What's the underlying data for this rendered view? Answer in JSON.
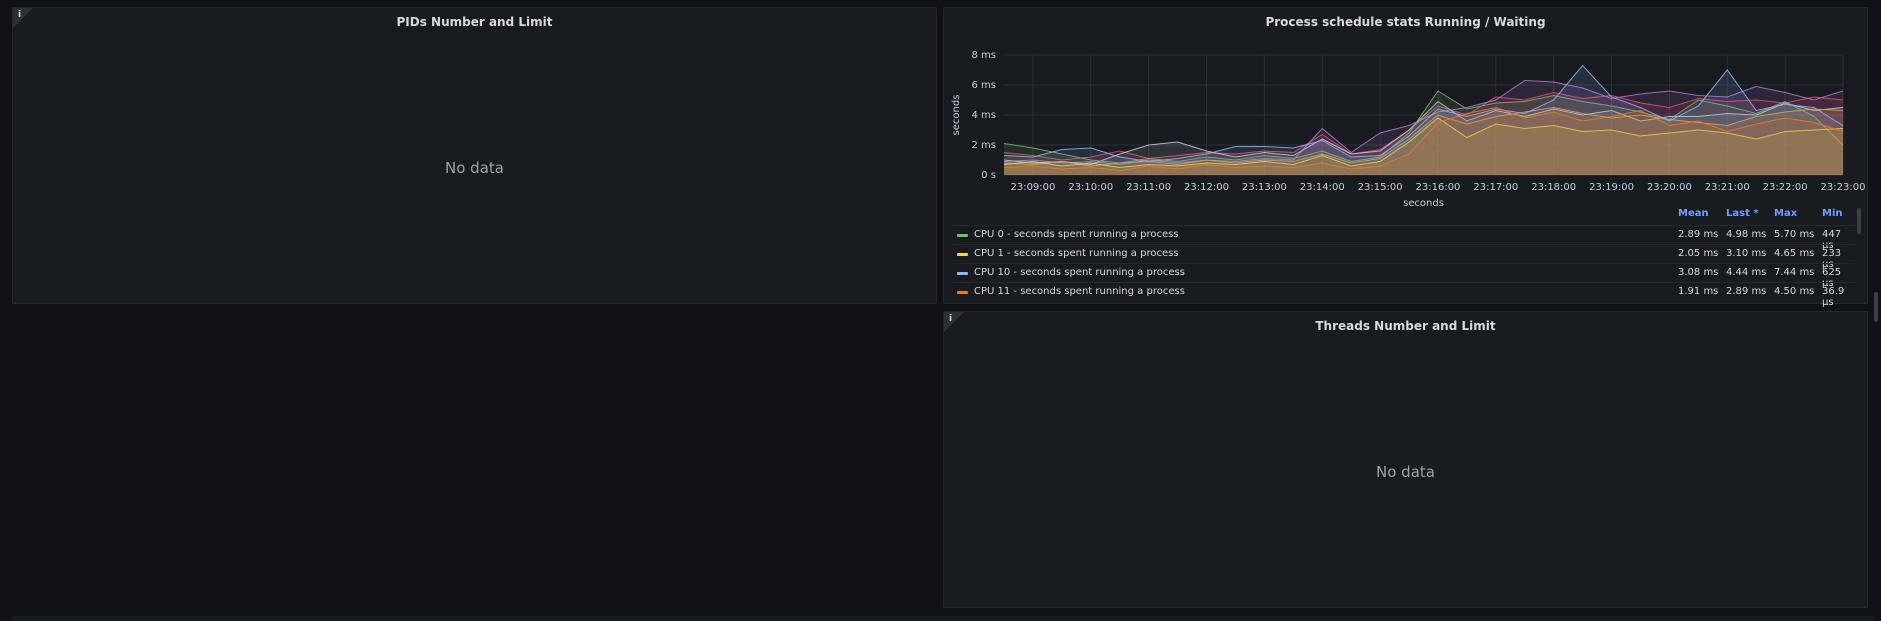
{
  "panels": {
    "pids": {
      "title": "PIDs Number and Limit",
      "empty_text": "No data"
    },
    "sched": {
      "title": "Process schedule stats Running / Waiting"
    },
    "threads": {
      "title": "Threads Number and Limit",
      "empty_text": "No data"
    }
  },
  "chart_data": {
    "type": "area",
    "title": "Process schedule stats Running / Waiting",
    "xlabel": "seconds",
    "ylabel": "seconds",
    "x": [
      "23:08:30",
      "23:09:00",
      "23:09:30",
      "23:10:00",
      "23:10:30",
      "23:11:00",
      "23:11:30",
      "23:12:00",
      "23:12:30",
      "23:13:00",
      "23:13:30",
      "23:14:00",
      "23:14:30",
      "23:15:00",
      "23:15:30",
      "23:16:00",
      "23:16:30",
      "23:17:00",
      "23:17:30",
      "23:18:00",
      "23:18:30",
      "23:19:00",
      "23:19:30",
      "23:20:00",
      "23:20:30",
      "23:21:00",
      "23:21:30",
      "23:22:00",
      "23:22:30",
      "23:23:00"
    ],
    "x_ticks": [
      "23:09:00",
      "23:10:00",
      "23:11:00",
      "23:12:00",
      "23:13:00",
      "23:14:00",
      "23:15:00",
      "23:16:00",
      "23:17:00",
      "23:18:00",
      "23:19:00",
      "23:20:00",
      "23:21:00",
      "23:22:00",
      "23:23:00"
    ],
    "y_ticks": [
      "0 s",
      "2 ms",
      "4 ms",
      "6 ms",
      "8 ms"
    ],
    "ylim": [
      0,
      8
    ],
    "y_unit": "ms",
    "grid": true,
    "legend_position": "bottom",
    "series": [
      {
        "name": "CPU 0 - seconds spent running a process",
        "color": "#73bf69",
        "values": [
          2.1,
          1.8,
          1.4,
          1.0,
          0.8,
          1.1,
          0.9,
          1.2,
          1.0,
          1.3,
          1.1,
          1.6,
          0.9,
          1.2,
          2.8,
          5.6,
          4.4,
          4.8,
          4.9,
          5.3,
          4.9,
          4.6,
          4.2,
          3.7,
          5.0,
          4.6,
          4.1,
          4.9,
          3.9,
          2.0
        ]
      },
      {
        "name": "CPU 1 - seconds spent running a process",
        "color": "#fade2a",
        "values": [
          0.7,
          0.9,
          0.6,
          0.8,
          0.5,
          0.7,
          0.6,
          0.8,
          0.7,
          0.9,
          0.7,
          1.3,
          0.6,
          0.9,
          2.2,
          3.8,
          2.5,
          3.4,
          3.1,
          3.3,
          2.9,
          3.0,
          2.6,
          2.8,
          3.0,
          2.8,
          2.4,
          2.9,
          3.0,
          3.1
        ]
      },
      {
        "name": "CPU 10 - seconds spent running a process",
        "color": "#8ab8ff",
        "values": [
          1.3,
          1.2,
          1.7,
          1.8,
          1.2,
          0.9,
          1.1,
          1.4,
          1.9,
          1.9,
          1.8,
          2.3,
          1.2,
          1.3,
          2.6,
          4.4,
          3.9,
          4.4,
          4.1,
          5.0,
          7.3,
          5.2,
          4.5,
          3.6,
          4.6,
          7.0,
          4.3,
          4.7,
          4.5,
          3.3
        ]
      },
      {
        "name": "CPU 11 - seconds spent running a process",
        "color": "#ff780a",
        "values": [
          0.5,
          0.6,
          0.4,
          0.5,
          0.3,
          0.6,
          0.4,
          0.7,
          0.5,
          0.6,
          0.5,
          0.8,
          0.4,
          0.6,
          1.4,
          3.5,
          4.1,
          4.5,
          3.8,
          4.2,
          3.6,
          3.9,
          4.3,
          3.3,
          3.6,
          2.9,
          3.4,
          3.8,
          3.5,
          2.9
        ]
      }
    ],
    "background_series": [
      {
        "color": "#f2495c",
        "values": [
          1.5,
          1.3,
          1.0,
          1.2,
          1.6,
          1.1,
          1.3,
          1.5,
          1.4,
          1.6,
          1.5,
          2.7,
          1.4,
          1.7,
          3.0,
          4.6,
          4.0,
          5.2,
          5.0,
          5.5,
          5.1,
          5.3,
          4.8,
          4.5,
          5.1,
          4.9,
          5.0,
          4.8,
          5.2,
          5.0
        ]
      },
      {
        "color": "#b877d9",
        "values": [
          0.9,
          1.0,
          0.8,
          0.9,
          0.7,
          1.0,
          0.8,
          1.0,
          0.9,
          1.1,
          1.0,
          3.1,
          1.5,
          2.8,
          3.3,
          4.2,
          4.5,
          5.0,
          6.3,
          6.2,
          5.8,
          5.1,
          5.4,
          5.6,
          5.3,
          5.2,
          5.9,
          5.5,
          5.0,
          5.6
        ]
      },
      {
        "color": "#ccccdc",
        "values": [
          1.0,
          0.8,
          0.9,
          0.7,
          1.4,
          2.0,
          2.2,
          1.6,
          1.2,
          1.5,
          1.3,
          2.4,
          1.4,
          1.6,
          3.0,
          4.9,
          3.6,
          4.3,
          3.9,
          4.4,
          4.0,
          4.3,
          3.6,
          3.9,
          3.9,
          4.1,
          4.0,
          4.8,
          4.3,
          4.5
        ]
      },
      {
        "color": "#ff9830",
        "values": [
          0.8,
          0.7,
          0.9,
          0.6,
          0.8,
          0.9,
          0.7,
          1.0,
          0.8,
          1.0,
          0.9,
          1.4,
          0.8,
          1.1,
          2.4,
          4.0,
          3.4,
          3.9,
          4.2,
          4.5,
          4.1,
          3.8,
          4.0,
          3.7,
          3.5,
          3.3,
          3.9,
          4.2,
          4.4,
          4.3
        ]
      }
    ]
  },
  "legend": {
    "headers": {
      "mean": "Mean",
      "last": "Last *",
      "max": "Max",
      "min": "Min"
    },
    "rows": [
      {
        "name": "CPU 0 - seconds spent running a process",
        "color": "#73bf69",
        "mean": "2.89 ms",
        "last": "4.98 ms",
        "max": "5.70 ms",
        "min": "447 µs"
      },
      {
        "name": "CPU 1 - seconds spent running a process",
        "color": "#fade2a",
        "mean": "2.05 ms",
        "last": "3.10 ms",
        "max": "4.65 ms",
        "min": "233 µs"
      },
      {
        "name": "CPU 10 - seconds spent running a process",
        "color": "#8ab8ff",
        "mean": "3.08 ms",
        "last": "4.44 ms",
        "max": "7.44 ms",
        "min": "625 µs"
      },
      {
        "name": "CPU 11 - seconds spent running a process",
        "color": "#ff780a",
        "mean": "1.91 ms",
        "last": "2.89 ms",
        "max": "4.50 ms",
        "min": "36.9 µs"
      }
    ]
  },
  "icons": {
    "info": "info-icon",
    "info_glyph": "i"
  }
}
